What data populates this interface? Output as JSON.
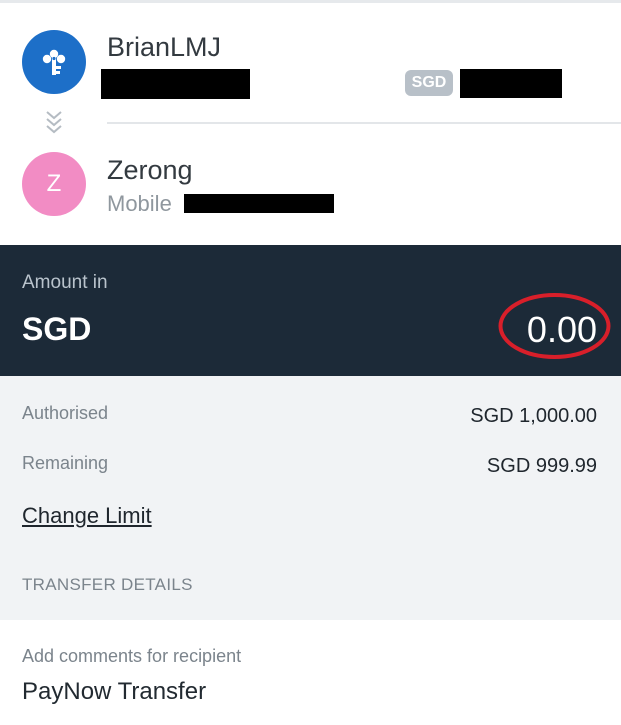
{
  "sender": {
    "name": "BrianLMJ",
    "currency_badge": "SGD",
    "icon": "bank-key-icon",
    "avatar_color": "#1d6fc8"
  },
  "recipient": {
    "name": "Zerong",
    "initial": "Z",
    "type_label": "Mobile",
    "avatar_color": "#f28cc4"
  },
  "amount": {
    "label": "Amount in",
    "currency": "SGD",
    "value": "0.00",
    "panel_color": "#1c2a38",
    "highlight_color": "#d81f2a"
  },
  "limits": {
    "authorised_label": "Authorised",
    "authorised_value": "SGD 1,000.00",
    "remaining_label": "Remaining",
    "remaining_value": "SGD 999.99",
    "change_limit_label": "Change Limit"
  },
  "transfer_details": {
    "section_title": "TRANSFER DETAILS",
    "comments_label": "Add comments for recipient",
    "comments_value": "PayNow Transfer"
  }
}
